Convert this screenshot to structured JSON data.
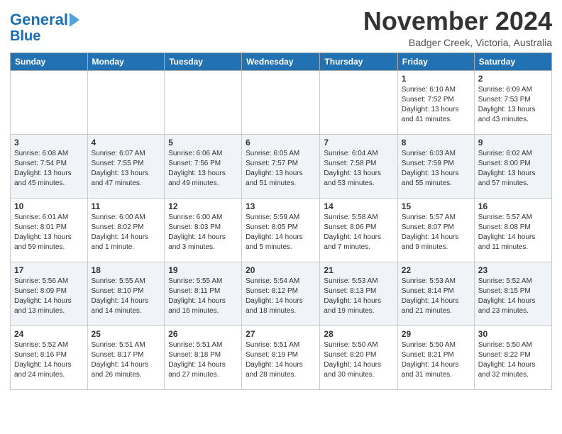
{
  "logo": {
    "line1": "General",
    "line2": "Blue"
  },
  "title": "November 2024",
  "subtitle": "Badger Creek, Victoria, Australia",
  "weekdays": [
    "Sunday",
    "Monday",
    "Tuesday",
    "Wednesday",
    "Thursday",
    "Friday",
    "Saturday"
  ],
  "weeks": [
    [
      {
        "day": "",
        "info": ""
      },
      {
        "day": "",
        "info": ""
      },
      {
        "day": "",
        "info": ""
      },
      {
        "day": "",
        "info": ""
      },
      {
        "day": "",
        "info": ""
      },
      {
        "day": "1",
        "info": "Sunrise: 6:10 AM\nSunset: 7:52 PM\nDaylight: 13 hours\nand 41 minutes."
      },
      {
        "day": "2",
        "info": "Sunrise: 6:09 AM\nSunset: 7:53 PM\nDaylight: 13 hours\nand 43 minutes."
      }
    ],
    [
      {
        "day": "3",
        "info": "Sunrise: 6:08 AM\nSunset: 7:54 PM\nDaylight: 13 hours\nand 45 minutes."
      },
      {
        "day": "4",
        "info": "Sunrise: 6:07 AM\nSunset: 7:55 PM\nDaylight: 13 hours\nand 47 minutes."
      },
      {
        "day": "5",
        "info": "Sunrise: 6:06 AM\nSunset: 7:56 PM\nDaylight: 13 hours\nand 49 minutes."
      },
      {
        "day": "6",
        "info": "Sunrise: 6:05 AM\nSunset: 7:57 PM\nDaylight: 13 hours\nand 51 minutes."
      },
      {
        "day": "7",
        "info": "Sunrise: 6:04 AM\nSunset: 7:58 PM\nDaylight: 13 hours\nand 53 minutes."
      },
      {
        "day": "8",
        "info": "Sunrise: 6:03 AM\nSunset: 7:59 PM\nDaylight: 13 hours\nand 55 minutes."
      },
      {
        "day": "9",
        "info": "Sunrise: 6:02 AM\nSunset: 8:00 PM\nDaylight: 13 hours\nand 57 minutes."
      }
    ],
    [
      {
        "day": "10",
        "info": "Sunrise: 6:01 AM\nSunset: 8:01 PM\nDaylight: 13 hours\nand 59 minutes."
      },
      {
        "day": "11",
        "info": "Sunrise: 6:00 AM\nSunset: 8:02 PM\nDaylight: 14 hours\nand 1 minute."
      },
      {
        "day": "12",
        "info": "Sunrise: 6:00 AM\nSunset: 8:03 PM\nDaylight: 14 hours\nand 3 minutes."
      },
      {
        "day": "13",
        "info": "Sunrise: 5:59 AM\nSunset: 8:05 PM\nDaylight: 14 hours\nand 5 minutes."
      },
      {
        "day": "14",
        "info": "Sunrise: 5:58 AM\nSunset: 8:06 PM\nDaylight: 14 hours\nand 7 minutes."
      },
      {
        "day": "15",
        "info": "Sunrise: 5:57 AM\nSunset: 8:07 PM\nDaylight: 14 hours\nand 9 minutes."
      },
      {
        "day": "16",
        "info": "Sunrise: 5:57 AM\nSunset: 8:08 PM\nDaylight: 14 hours\nand 11 minutes."
      }
    ],
    [
      {
        "day": "17",
        "info": "Sunrise: 5:56 AM\nSunset: 8:09 PM\nDaylight: 14 hours\nand 13 minutes."
      },
      {
        "day": "18",
        "info": "Sunrise: 5:55 AM\nSunset: 8:10 PM\nDaylight: 14 hours\nand 14 minutes."
      },
      {
        "day": "19",
        "info": "Sunrise: 5:55 AM\nSunset: 8:11 PM\nDaylight: 14 hours\nand 16 minutes."
      },
      {
        "day": "20",
        "info": "Sunrise: 5:54 AM\nSunset: 8:12 PM\nDaylight: 14 hours\nand 18 minutes."
      },
      {
        "day": "21",
        "info": "Sunrise: 5:53 AM\nSunset: 8:13 PM\nDaylight: 14 hours\nand 19 minutes."
      },
      {
        "day": "22",
        "info": "Sunrise: 5:53 AM\nSunset: 8:14 PM\nDaylight: 14 hours\nand 21 minutes."
      },
      {
        "day": "23",
        "info": "Sunrise: 5:52 AM\nSunset: 8:15 PM\nDaylight: 14 hours\nand 23 minutes."
      }
    ],
    [
      {
        "day": "24",
        "info": "Sunrise: 5:52 AM\nSunset: 8:16 PM\nDaylight: 14 hours\nand 24 minutes."
      },
      {
        "day": "25",
        "info": "Sunrise: 5:51 AM\nSunset: 8:17 PM\nDaylight: 14 hours\nand 26 minutes."
      },
      {
        "day": "26",
        "info": "Sunrise: 5:51 AM\nSunset: 8:18 PM\nDaylight: 14 hours\nand 27 minutes."
      },
      {
        "day": "27",
        "info": "Sunrise: 5:51 AM\nSunset: 8:19 PM\nDaylight: 14 hours\nand 28 minutes."
      },
      {
        "day": "28",
        "info": "Sunrise: 5:50 AM\nSunset: 8:20 PM\nDaylight: 14 hours\nand 30 minutes."
      },
      {
        "day": "29",
        "info": "Sunrise: 5:50 AM\nSunset: 8:21 PM\nDaylight: 14 hours\nand 31 minutes."
      },
      {
        "day": "30",
        "info": "Sunrise: 5:50 AM\nSunset: 8:22 PM\nDaylight: 14 hours\nand 32 minutes."
      }
    ]
  ]
}
